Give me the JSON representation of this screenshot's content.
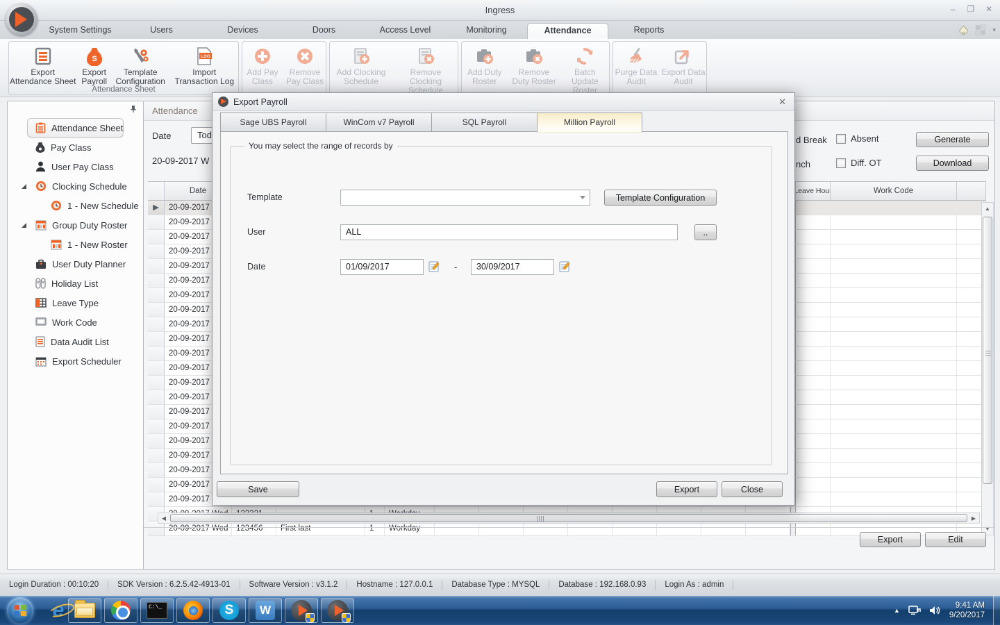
{
  "window": {
    "title": "Ingress"
  },
  "ribbon_tabs": {
    "items": [
      "System Settings",
      "Users",
      "Devices",
      "Doors",
      "Access Level",
      "Monitoring",
      "Attendance",
      "Reports"
    ],
    "active": "Attendance"
  },
  "ribbon": {
    "group1_label": "Attendance Sheet",
    "buttons": {
      "export_attendance_sheet": "Export Attendance Sheet",
      "export_payroll": "Export Payroll",
      "template_configuration": "Template Configuration",
      "import_transaction_log": "Import Transaction Log",
      "add_pay_class": "Add Pay Class",
      "remove_pay_class": "Remove Pay Class",
      "add_clocking_schedule": "Add Clocking Schedule",
      "remove_clocking_schedule": "Remove Clocking Schedule",
      "add_duty_roster": "Add Duty Roster",
      "remove_duty_roster": "Remove Duty Roster",
      "batch_update_roster": "Batch Update Roster",
      "purge_data_audit": "Purge Data Audit",
      "export_data_audit": "Export Data Audit"
    }
  },
  "sidebar": {
    "items": [
      {
        "label": "Attendance Sheet"
      },
      {
        "label": "Pay Class"
      },
      {
        "label": "User Pay Class"
      },
      {
        "label": "Clocking Schedule"
      },
      {
        "label": "1 - New Schedule"
      },
      {
        "label": "Group Duty Roster"
      },
      {
        "label": "1 - New Roster"
      },
      {
        "label": "User Duty Planner"
      },
      {
        "label": "Holiday List"
      },
      {
        "label": "Leave Type"
      },
      {
        "label": "Work Code"
      },
      {
        "label": "Data Audit List"
      },
      {
        "label": "Export Scheduler"
      }
    ]
  },
  "attendance": {
    "tab_label": "Attendance",
    "date_label": "Date",
    "date_dropdown_value": "Tod",
    "current_date": "20-09-2017 W",
    "header_date": "Date",
    "partial_row_date": "20-09-2017 W",
    "partial_row_count": 21,
    "full_rows": [
      {
        "date": "20-09-2017  Wed",
        "user_id": "123321",
        "name": "",
        "col4": "1",
        "day_type": "Workday"
      },
      {
        "date": "20-09-2017  Wed",
        "user_id": "123456",
        "name": "First last",
        "col4": "1",
        "day_type": "Workday"
      }
    ],
    "leave_hour_header": "Leave Hour",
    "work_code_header": "Work Code"
  },
  "right_panel": {
    "break_fragment": "d Break",
    "lunch_fragment": "nch",
    "absent_label": "Absent",
    "diff_ot_label": "Diff. OT",
    "generate_button": "Generate",
    "download_button": "Download",
    "export_button": "Export",
    "edit_button": "Edit"
  },
  "status_bar": {
    "items": [
      "Login Duration : 00:10:20",
      "SDK Version : 6.2.5.42-4913-01",
      "Software Version : v3.1.2",
      "Hostname : 127.0.0.1",
      "Database Type : MYSQL",
      "Database : 192.168.0.93",
      "Login As : admin"
    ]
  },
  "dialog": {
    "title": "Export Payroll",
    "tabs": [
      "Sage UBS Payroll",
      "WinCom v7 Payroll",
      "SQL Payroll",
      "Million Payroll"
    ],
    "active_tab": "Million Payroll",
    "groupbox_label": "You may select the range of records by",
    "template_label": "Template",
    "template_value": "",
    "template_config_button": "Template Configuration",
    "user_label": "User",
    "user_value": "ALL",
    "browse_button": "..",
    "date_label": "Date",
    "date_from": "01/09/2017",
    "date_separator": "-",
    "date_to": "30/09/2017",
    "save_button": "Save",
    "export_button": "Export",
    "close_button": "Close"
  },
  "taskbar": {
    "tray_time": "9:41 AM",
    "tray_date": "9/20/2017"
  }
}
